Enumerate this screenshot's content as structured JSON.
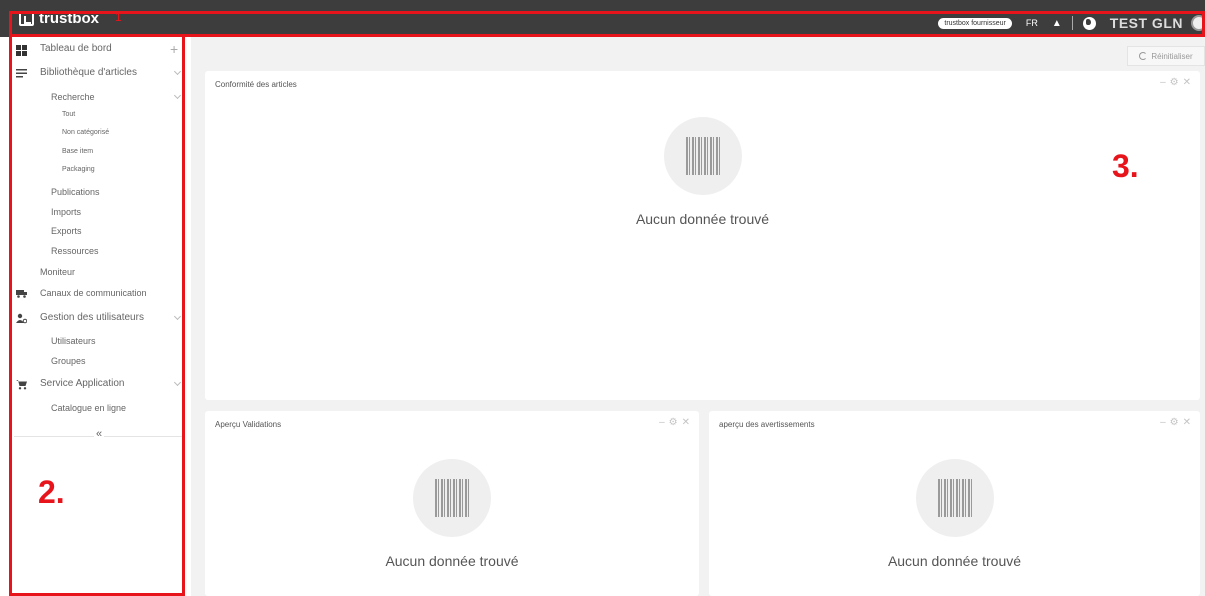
{
  "topbar": {
    "brand": "trustbox",
    "marker": "1",
    "role_badge": "trustbox fournisseur",
    "language": "FR",
    "bell_icon": "bell-icon",
    "globe_icon": "globe-icon",
    "account_name": "TEST GLN"
  },
  "sidebar": {
    "dashboard": "Tableau de bord",
    "library": "Bibliothèque d'articles",
    "search": "Recherche",
    "all": "Tout",
    "uncategorized": "Non catégorisé",
    "base_item": "Base item",
    "packaging": "Packaging",
    "publications": "Publications",
    "imports": "Imports",
    "exports": "Exports",
    "resources": "Ressources",
    "monitor": "Moniteur",
    "channels": "Canaux de communication",
    "user_mgmt": "Gestion des utilisateurs",
    "users": "Utilisateurs",
    "groups": "Groupes",
    "service_app": "Service Application",
    "online_catalog": "Catalogue en ligne",
    "collapse_glyph": "«",
    "marker": "2."
  },
  "main": {
    "reset_label": "Réinitialiser",
    "marker": "3.",
    "cards": {
      "compliance": {
        "title": "Conformité des articles",
        "empty": "Aucun donnée trouvé"
      },
      "validations": {
        "title": "Aperçu Validations",
        "empty": "Aucun donnée trouvé"
      },
      "warnings": {
        "title": "aperçu des avertissements",
        "empty": "Aucun donnée trouvé"
      }
    }
  },
  "colors": {
    "topbar_bg": "#3d3d3d",
    "annotation_red": "#e8141b",
    "page_bg": "#f2f2f2"
  }
}
